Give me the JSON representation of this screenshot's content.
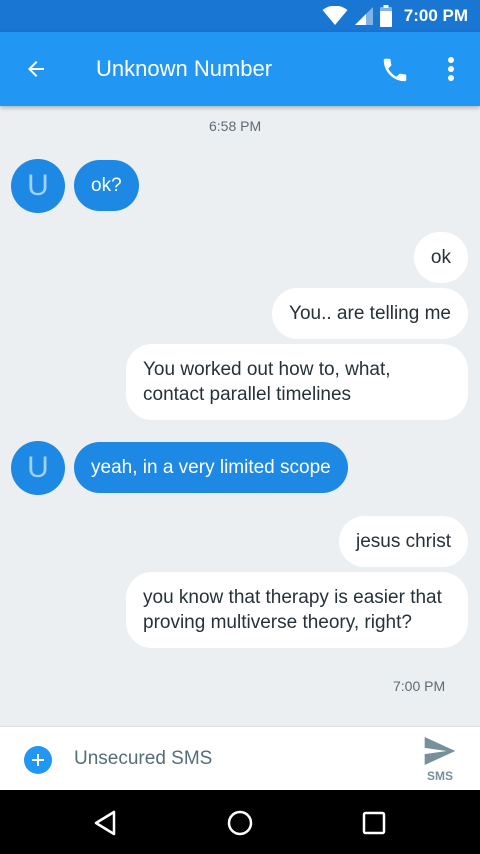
{
  "status_bar": {
    "time": "7:00 PM",
    "icons": [
      "wifi-icon",
      "signal-icon",
      "battery-icon"
    ]
  },
  "app_bar": {
    "title": "Unknown Number",
    "icons": [
      "back-arrow-icon",
      "phone-icon",
      "more-vert-icon"
    ]
  },
  "conversation": {
    "timestamp_top": "6:58 PM",
    "timestamp_bottom": "7:00 PM",
    "avatar_letter": "U",
    "messages": [
      {
        "direction": "incoming",
        "text": "ok?"
      },
      {
        "direction": "outgoing",
        "text": "ok"
      },
      {
        "direction": "outgoing",
        "text": "You.. are telling me"
      },
      {
        "direction": "outgoing",
        "text": "You worked out how to, what, contact parallel timelines"
      },
      {
        "direction": "incoming",
        "text": "yeah, in a very limited scope"
      },
      {
        "direction": "outgoing",
        "text": "jesus christ"
      },
      {
        "direction": "outgoing",
        "text": "you know that therapy is easier that proving multiverse theory, right?"
      }
    ]
  },
  "compose": {
    "placeholder": "Unsecured SMS",
    "send_label": "SMS",
    "icons": [
      "add-icon",
      "send-icon"
    ]
  },
  "nav_bar": {
    "icons": [
      "back-nav-icon",
      "home-nav-icon",
      "recents-nav-icon"
    ]
  },
  "colors": {
    "app_bar": "#2196f3",
    "status_bar": "#1976d2",
    "incoming_bubble": "#1e88e5",
    "outgoing_bubble": "#ffffff",
    "background": "#eceff1"
  }
}
